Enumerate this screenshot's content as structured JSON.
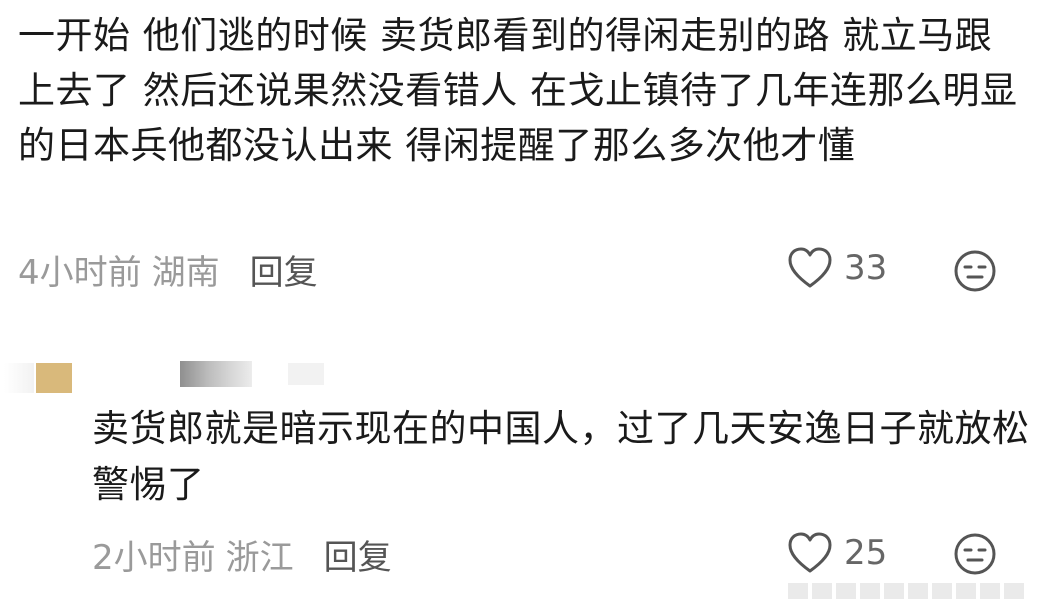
{
  "comment1": {
    "text": "一开始 他们逃的时候 卖货郎看到的得闲走别的路 就立马跟上去了 然后还说果然没看错人 在戈止镇待了几年连那么明显的日本兵他都没认出来 得闲提醒了那么多次他才懂",
    "time": "4小时前",
    "region": "湖南",
    "reply_label": "回复",
    "like_count": "33",
    "like_icon": "heart-outline-icon",
    "reaction_icon": "neutral-face-icon"
  },
  "comment2": {
    "text": "卖货郎就是暗示现在的中国人，过了几天安逸日子就放松警惕了",
    "time": "2小时前",
    "region": "浙江",
    "reply_label": "回复",
    "like_count": "25",
    "like_icon": "heart-outline-icon",
    "reaction_icon": "neutral-face-icon",
    "avatar_color": "#d9b97b"
  },
  "colors": {
    "text_primary": "#1a1a1a",
    "text_meta": "#9a9a9a",
    "icon": "#555555"
  }
}
